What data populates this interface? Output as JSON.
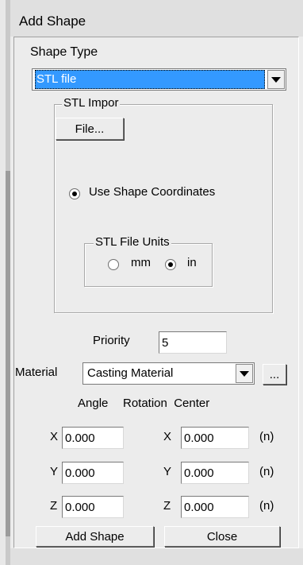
{
  "window": {
    "title": "Add Shape"
  },
  "shape_type": {
    "label": "Shape Type",
    "selected": "STL file"
  },
  "stl_import": {
    "group_label": "STL Impor",
    "file_button": "File...",
    "use_coords_label": "Use Shape Coordinates",
    "use_coords_checked": true,
    "units": {
      "group_label": "STL File Units",
      "options": [
        {
          "label": "mm",
          "checked": false
        },
        {
          "label": "in",
          "checked": true
        }
      ]
    }
  },
  "priority": {
    "label": "Priority",
    "value": "5"
  },
  "material": {
    "label": "Material",
    "selected": "Casting Material",
    "browse_button": "..."
  },
  "angle_header": "Angle",
  "rotation_center_header": "Rotation  Center",
  "angles": [
    {
      "axis": "X",
      "value": "0.000"
    },
    {
      "axis": "Y",
      "value": "0.000"
    },
    {
      "axis": "Z",
      "value": "0.000"
    }
  ],
  "centers": [
    {
      "axis": "X",
      "value": "0.000",
      "unit": "(n)"
    },
    {
      "axis": "Y",
      "value": "0.000",
      "unit": "(n)"
    },
    {
      "axis": "Z",
      "value": "0.000",
      "unit": "(n)"
    }
  ],
  "buttons": {
    "add": "Add Shape",
    "close": "Close"
  }
}
